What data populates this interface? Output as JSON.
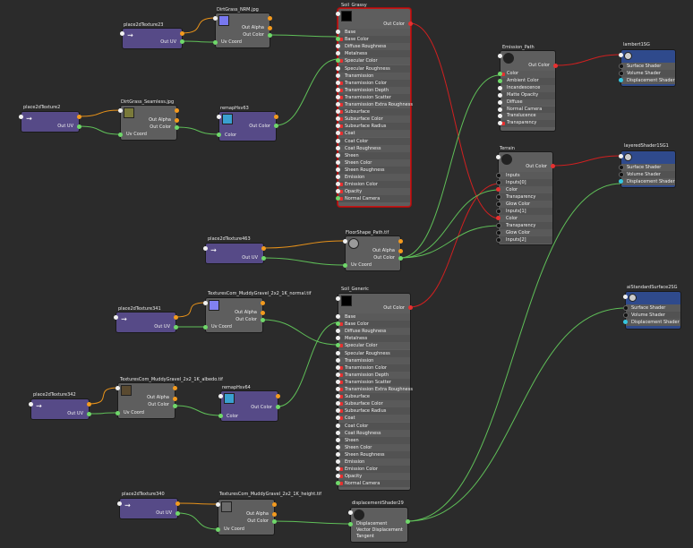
{
  "nodes": {
    "place2dTexture23": {
      "title": "place2dTexture23",
      "out": "Out UV"
    },
    "DirtGrass_NRM": {
      "title": "DirtGrass_NRM.jpg",
      "outs": [
        "Out Alpha",
        "Out Color"
      ],
      "in": "Uv Coord"
    },
    "place2dTexture2": {
      "title": "place2dTexture2",
      "out": "Out UV"
    },
    "DirtGrass_Seamless": {
      "title": "DirtGrass_Seamless.jpg",
      "outs": [
        "Out Alpha",
        "Out Color"
      ],
      "in": "Uv Coord"
    },
    "remapHsv63": {
      "title": "remapHsv63",
      "out": "Out Color",
      "in": "Color"
    },
    "Soil_Grassy": {
      "title": "Soil_Grassy",
      "out": "Out Color"
    },
    "Soil_Generic": {
      "title": "Soil_Generic",
      "out": "Out Color"
    },
    "place2dTexture463": {
      "title": "place2dTexture463",
      "out": "Out UV"
    },
    "FloorShape_Path": {
      "title": "FloorShape_Path.tif",
      "outs": [
        "Out Alpha",
        "Out Color"
      ],
      "in": "Uv Coord"
    },
    "place2dTexture341": {
      "title": "place2dTexture341",
      "out": "Out UV"
    },
    "TexNormal": {
      "title": "TexturesCom_MuddyGravel_2x2_1K_normal.tif",
      "outs": [
        "Out Alpha",
        "Out Color"
      ],
      "in": "Uv Coord"
    },
    "place2dTexture342": {
      "title": "place2dTexture342",
      "out": "Out UV"
    },
    "TexAlbedo": {
      "title": "TexturesCom_MuddyGravel_2x2_1K_albedo.tif",
      "outs": [
        "Out Alpha",
        "Out Color"
      ],
      "in": "Uv Coord"
    },
    "remapHsv64": {
      "title": "remapHsv64",
      "out": "Out Color",
      "in": "Color"
    },
    "place2dTexture340": {
      "title": "place2dTexture340",
      "out": "Out UV"
    },
    "TexHeight": {
      "title": "TexturesCom_MuddyGravel_2x2_1K_height.tif",
      "outs": [
        "Out Alpha",
        "Out Color"
      ],
      "in": "Uv Coord"
    },
    "displacementShader29": {
      "title": "displacementShader29",
      "ins": [
        "Displacement",
        "Vector Displacement",
        "Tangent"
      ]
    },
    "Emission_Path": {
      "title": "Emission_Path",
      "out": "Out Color",
      "ins": [
        "Color",
        "Ambient Color",
        "Incandescence",
        "Matte Opacity",
        "Diffuse",
        "Normal Camera",
        "Translucence",
        "Transparency"
      ]
    },
    "Terrain": {
      "title": "Terrain",
      "out": "Out Color",
      "ins": [
        "Inputs",
        "Inputs[0]",
        "Color",
        "Transparency",
        "Glow Color",
        "Inputs[1]",
        "Color",
        "Transparency",
        "Glow Color",
        "Inputs[2]"
      ]
    },
    "lambert1SG": {
      "title": "lambert1SG",
      "ins": [
        "Surface Shader",
        "Volume Shader",
        "Displacement Shader"
      ]
    },
    "layeredShader1SG1": {
      "title": "layeredShader1SG1",
      "ins": [
        "Surface Shader",
        "Volume Shader",
        "Displacement Shader"
      ]
    },
    "aiStandardSurface": {
      "title": "aiStandardSurface2SG",
      "ins": [
        "Surface Shader",
        "Volume Shader",
        "Displacement Shader"
      ]
    }
  },
  "standard_attrs": [
    "Base",
    "Base Color",
    "Diffuse Roughness",
    "Metalness",
    "Specular Color",
    "Specular Roughness",
    "Transmission",
    "Transmission Color",
    "Transmission Depth",
    "Transmission Scatter",
    "Transmission Extra Roughness",
    "Subsurface",
    "Subsurface Color",
    "Subsurface Radius",
    "Coat",
    "Coat Color",
    "Coat Roughness",
    "Sheen",
    "Sheen Color",
    "Sheen Roughness",
    "Emission",
    "Emission Color",
    "Opacity",
    "Normal Camera"
  ],
  "colors": {
    "bg": "#2b2b2b",
    "purple": "#564a87",
    "gray": "#5e5e5e",
    "blue": "#2f4a8c",
    "wire_green": "#5fbf58",
    "wire_red": "#d02020",
    "wire_orange": "#e6911a"
  }
}
